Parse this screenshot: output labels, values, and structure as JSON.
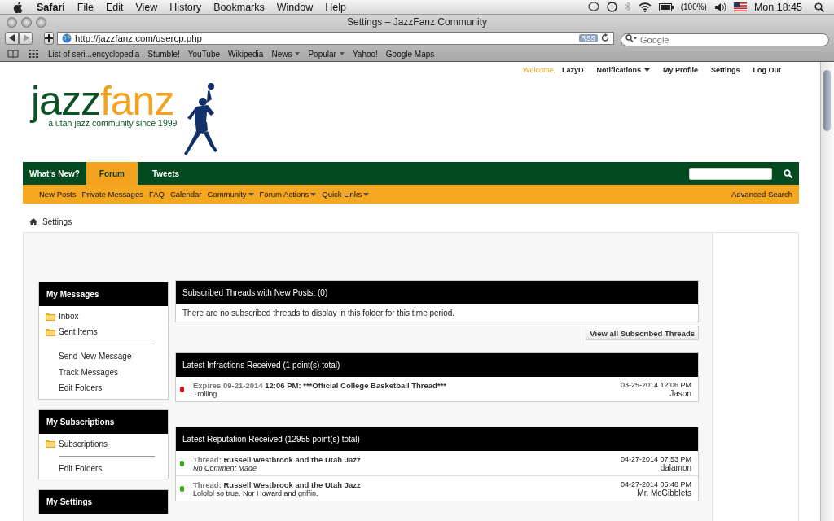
{
  "menubar": {
    "app": "Safari",
    "menus": [
      "File",
      "Edit",
      "View",
      "History",
      "Bookmarks",
      "Window",
      "Help"
    ],
    "battery": "(100%)",
    "clock": "Mon 18:45"
  },
  "window": {
    "title": "Settings – JazzFanz Community"
  },
  "toolbar": {
    "url": "http://jazzfanz.com/usercp.php",
    "rss": "RSS",
    "search_placeholder": "Google"
  },
  "bookmarks": [
    {
      "label": "List of seri...encyclopedia",
      "menu": false
    },
    {
      "label": "Stumble!",
      "menu": false
    },
    {
      "label": "YouTube",
      "menu": false
    },
    {
      "label": "Wikipedia",
      "menu": false
    },
    {
      "label": "News",
      "menu": true
    },
    {
      "label": "Popular",
      "menu": true
    },
    {
      "label": "Yahoo!",
      "menu": false
    },
    {
      "label": "Google Maps",
      "menu": false
    }
  ],
  "userbar": {
    "welcome": "Welcome,",
    "user": "LazyD",
    "links": [
      {
        "label": "Notifications",
        "menu": true
      },
      {
        "label": "My Profile",
        "menu": false
      },
      {
        "label": "Settings",
        "menu": false
      },
      {
        "label": "Log Out",
        "menu": false
      }
    ]
  },
  "logo": {
    "part1": "jazz",
    "part2": "fanz",
    "tagline": "a utah jazz community since 1999"
  },
  "nav_tabs": [
    {
      "label": "What's New?",
      "selected": false
    },
    {
      "label": "Forum",
      "selected": true
    },
    {
      "label": "Tweets",
      "selected": false
    }
  ],
  "subnav": [
    {
      "label": "New Posts",
      "menu": false
    },
    {
      "label": "Private Messages",
      "menu": false
    },
    {
      "label": "FAQ",
      "menu": false
    },
    {
      "label": "Calendar",
      "menu": false
    },
    {
      "label": "Community",
      "menu": true
    },
    {
      "label": "Forum Actions",
      "menu": true
    },
    {
      "label": "Quick Links",
      "menu": true
    }
  ],
  "advanced_search": "Advanced Search",
  "breadcrumb": "Settings",
  "sidebar": [
    {
      "title": "My Messages",
      "folders": [
        "Inbox",
        "Sent Items"
      ],
      "links": [
        "Send New Message",
        "Track Messages",
        "Edit Folders"
      ]
    },
    {
      "title": "My Subscriptions",
      "folders": [
        "Subscriptions"
      ],
      "links": [
        "Edit Folders"
      ]
    },
    {
      "title": "My Settings"
    }
  ],
  "subscribed": {
    "title": "Subscribed Threads with New Posts: (0)",
    "empty": "There are no subscribed threads to display in this folder for this time period.",
    "button": "View all Subscribed Threads"
  },
  "sections": [
    {
      "title": "Latest Infractions Received (1 point(s) total)",
      "rows": [
        {
          "color": "#dd1111",
          "label": "Expires 09-21-2014",
          "title": "12:06 PM: ***Official College Basketball Thread***",
          "comment": "Trolling",
          "italic": false,
          "date": "03-25-2014 12:06 PM",
          "user": "Jason"
        }
      ]
    },
    {
      "title": "Latest Reputation Received (12955 point(s) total)",
      "rows": [
        {
          "color": "#33aa11",
          "label": "Thread:",
          "title": "Russell Westbrook and the Utah Jazz",
          "comment": "No Comment Made",
          "italic": true,
          "date": "04-27-2014 07:53 PM",
          "user": "dalamon"
        },
        {
          "color": "#33aa11",
          "label": "Thread:",
          "title": "Russell Westbrook and the Utah Jazz",
          "comment": "Lololol so true. Nor Howard and griffin.",
          "italic": false,
          "date": "04-27-2014 05:48 PM",
          "user": "Mr. McGibblets"
        }
      ]
    }
  ]
}
